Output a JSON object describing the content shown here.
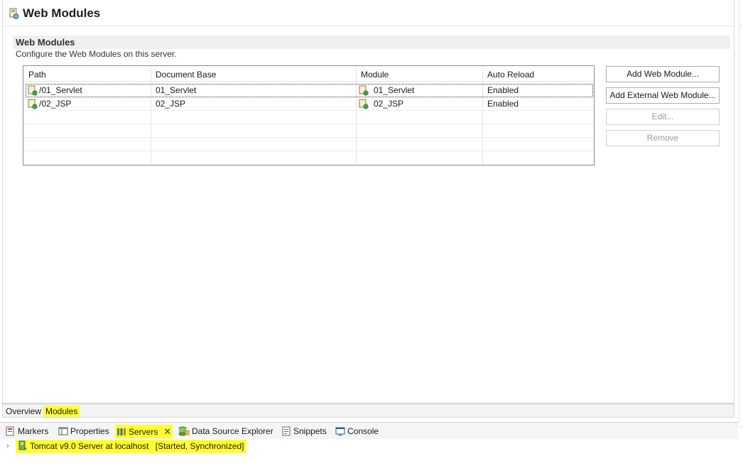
{
  "editor": {
    "title": "Web Modules",
    "section_title": "Web Modules",
    "section_desc": "Configure the Web Modules on this server."
  },
  "table": {
    "columns": [
      "Path",
      "Document Base",
      "Module",
      "Auto Reload"
    ],
    "rows": [
      {
        "path": "/01_Servlet",
        "doc_base": "01_Servlet",
        "module": "01_Servlet",
        "auto_reload": "Enabled"
      },
      {
        "path": "/02_JSP",
        "doc_base": "02_JSP",
        "module": "02_JSP",
        "auto_reload": "Enabled"
      }
    ]
  },
  "buttons": {
    "add_web_module": "Add Web Module...",
    "add_external": "Add External Web Module...",
    "edit": "Edit...",
    "remove": "Remove"
  },
  "editor_tabs": {
    "overview": "Overview",
    "modules": "Modules"
  },
  "views": {
    "markers": "Markers",
    "properties": "Properties",
    "servers": "Servers",
    "data_source": "Data Source Explorer",
    "snippets": "Snippets",
    "console": "Console"
  },
  "server": {
    "name": "Tomcat v9.0 Server at localhost",
    "status": "[Started, Synchronized]"
  },
  "colors": {
    "highlight": "#ffff33",
    "section_bg": "#eeeff1"
  }
}
